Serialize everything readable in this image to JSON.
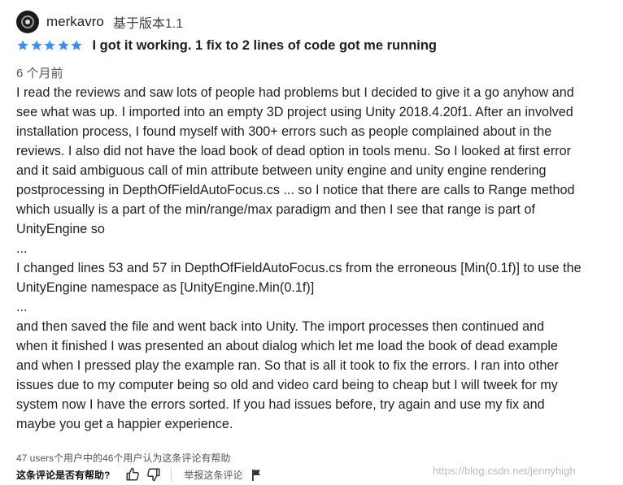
{
  "review": {
    "username": "merkavro",
    "version": "基于版本1.1",
    "rating": 5,
    "star_color": "#3d8dfb",
    "avatar_icon": "avatar-icon",
    "title": "I got it working. 1 fix to 2 lines of code got me running",
    "time_ago": "6 个月前",
    "body_lines": [
      "I read the reviews and saw lots of people had problems but I decided to give it a go anyhow and",
      "see what was up. I imported into an empty 3D project using Unity 2018.4.20f1. After an involved",
      "installation process, I found myself with 300+ errors such as people complained about in the",
      "reviews. I also did not have the load book of dead option in tools menu. So I looked at first error",
      "and it said ambiguous call of min attribute between unity engine and unity engine rendering",
      "postprocessing in DepthOfFieldAutoFocus.cs ... so I notice that there are calls to Range method",
      "which usually is a part of the min/range/max paradigm and then I see that range is part of",
      "UnityEngine so",
      "...",
      "I changed lines 53 and 57 in DepthOfFieldAutoFocus.cs from the erroneous [Min(0.1f)] to use the",
      "UnityEngine namespace as [UnityEngine.Min(0.1f)]",
      "...",
      "and then saved the file and went back into Unity. The import processes then continued and",
      "when it finished I was presented an about dialog which let me load the book of dead example",
      "and when I pressed play the example ran. So that is all  it took to fix the errors. I ran into other",
      "issues due to my computer being so old and video card being to cheap but I will tweek for my",
      "system now I have the errors sorted. If you had issues before, try again and use my fix and",
      "maybe you get a happier experience."
    ],
    "helpful_count": "47 users个用户中的46个用户认为这条评论有帮助",
    "helpful_question": "这条评论是否有帮助?",
    "report_label": "举报这条评论",
    "watermark": "https://blog.csdn.net/jennyhigh"
  }
}
